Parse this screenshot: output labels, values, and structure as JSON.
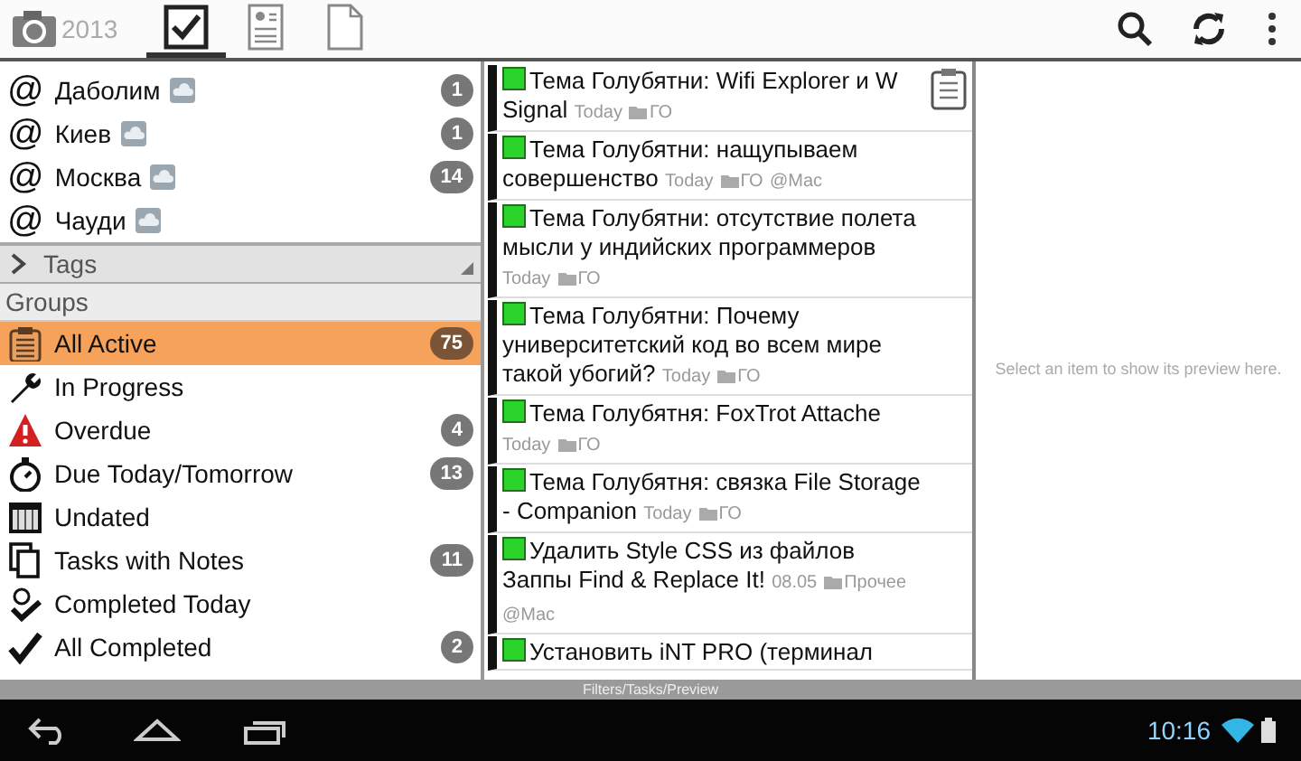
{
  "toolbar": {
    "date": "2013",
    "tabs": [
      {
        "kind": "check",
        "selected": true
      },
      {
        "kind": "contact",
        "selected": false
      },
      {
        "kind": "note",
        "selected": false
      }
    ],
    "actions": [
      {
        "kind": "search"
      },
      {
        "kind": "sync"
      },
      {
        "kind": "menu"
      }
    ]
  },
  "locations": [
    {
      "icon": "@",
      "name": "Даболим",
      "count": "1"
    },
    {
      "icon": "@",
      "name": "Киев",
      "count": "1"
    },
    {
      "icon": "@",
      "name": "Москва",
      "count": "14"
    },
    {
      "icon": "@",
      "name": "Чауди"
    }
  ],
  "tags_section": {
    "label": "Tags",
    "expanded": false
  },
  "groups": {
    "title": "Groups",
    "items": [
      {
        "kind": "list",
        "label": "All Active",
        "count": "75",
        "selected": true
      },
      {
        "kind": "wrench",
        "label": "In Progress",
        "selected": false
      },
      {
        "kind": "warning",
        "label": "Overdue",
        "count": "4",
        "selected": false
      },
      {
        "kind": "timer",
        "label": "Due Today/Tomorrow",
        "count": "13",
        "selected": false
      },
      {
        "kind": "calendar",
        "label": "Undated",
        "selected": false
      },
      {
        "kind": "pages",
        "label": "Tasks with Notes",
        "count": "11",
        "selected": false
      },
      {
        "kind": "timer-check",
        "label": "Completed Today",
        "selected": false
      },
      {
        "kind": "check",
        "label": "All Completed",
        "count": "2",
        "selected": false
      }
    ]
  },
  "tasks": [
    {
      "title": "Тема Голубятни: Wifi Explorer и W Signal",
      "date": "Today",
      "folder": "ГО"
    },
    {
      "title": "Тема Голубятни: нащупываем совершенство",
      "date": "Today",
      "folder": "ГО",
      "context": "@Mac"
    },
    {
      "title": "Тема Голубятни: отсутствие полета мысли у индийских программеров",
      "date": "Today",
      "folder": "ГО"
    },
    {
      "title": "Тема Голубятни: Почему университетский код во всем мире такой убогий?",
      "date": "Today",
      "folder": "ГО"
    },
    {
      "title": "Тема Голубятня: FoxTrot Attache",
      "date": "Today",
      "folder": "ГО"
    },
    {
      "title": "Тема Голубятня: связка File Storage - Companion",
      "date": "Today",
      "folder": "ГО"
    },
    {
      "title": "Удалить Style CSS из файлов Заппы Find & Replace It!",
      "date": "08.05",
      "folder": "Прочее",
      "context": "@Mac"
    },
    {
      "title": "Установить iNT PRO (терминал"
    }
  ],
  "preview": {
    "hint": "Select an item to show its preview here."
  },
  "footer": {
    "label": "Filters/Tasks/Preview"
  },
  "system_bar": {
    "time": "10:16"
  }
}
